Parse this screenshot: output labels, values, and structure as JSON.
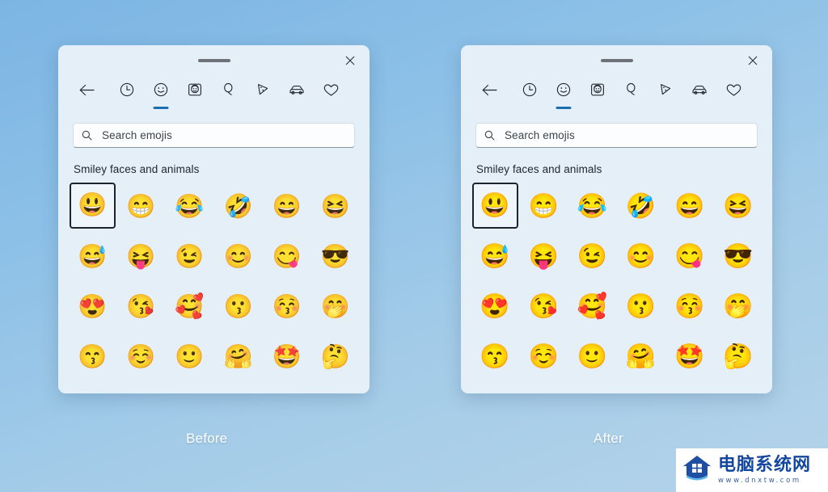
{
  "background": {
    "gradient_from": "#7cb5e3",
    "gradient_to": "#b4d3e9"
  },
  "panels": [
    {
      "id": "before",
      "caption": "Before",
      "titlebar": {
        "drag_handle_name": "drag-handle",
        "close_label": "×"
      },
      "tabs": [
        {
          "name": "back",
          "icon": "arrow-left-icon",
          "active": false
        },
        {
          "name": "recent",
          "icon": "clock-icon",
          "active": false
        },
        {
          "name": "emoji",
          "icon": "smiley-icon",
          "active": true
        },
        {
          "name": "gif",
          "icon": "person-icon",
          "active": false
        },
        {
          "name": "kaomoji",
          "icon": "balloon-icon",
          "active": false
        },
        {
          "name": "food",
          "icon": "pizza-icon",
          "active": false
        },
        {
          "name": "travel",
          "icon": "car-icon",
          "active": false
        },
        {
          "name": "symbols",
          "icon": "heart-icon",
          "active": false
        }
      ],
      "search": {
        "placeholder": "Search emojis",
        "value": "",
        "icon": "search-icon"
      },
      "section_title": "Smiley faces and animals",
      "grid": {
        "columns": 6,
        "selected_index": 0,
        "emojis": [
          {
            "glyph": "😃",
            "name": "grinning-face-with-big-eyes"
          },
          {
            "glyph": "😁",
            "name": "beaming-face-with-smiling-eyes"
          },
          {
            "glyph": "😂",
            "name": "face-with-tears-of-joy"
          },
          {
            "glyph": "🤣",
            "name": "rolling-on-the-floor-laughing"
          },
          {
            "glyph": "😄",
            "name": "grinning-face-with-smiling-eyes"
          },
          {
            "glyph": "😆",
            "name": "grinning-squinting-face"
          },
          {
            "glyph": "😅",
            "name": "grinning-face-with-sweat"
          },
          {
            "glyph": "😝",
            "name": "squinting-face-with-tongue"
          },
          {
            "glyph": "😉",
            "name": "winking-face"
          },
          {
            "glyph": "😊",
            "name": "smiling-face-with-smiling-eyes"
          },
          {
            "glyph": "😋",
            "name": "face-savoring-food"
          },
          {
            "glyph": "😎",
            "name": "smiling-face-with-sunglasses"
          },
          {
            "glyph": "😍",
            "name": "smiling-face-with-heart-eyes"
          },
          {
            "glyph": "😘",
            "name": "face-blowing-a-kiss"
          },
          {
            "glyph": "🥰",
            "name": "smiling-face-with-hearts"
          },
          {
            "glyph": "😗",
            "name": "kissing-face"
          },
          {
            "glyph": "😚",
            "name": "kissing-face-with-closed-eyes"
          },
          {
            "glyph": "🤭",
            "name": "face-with-hand-over-mouth"
          },
          {
            "glyph": "😙",
            "name": "kissing-face-with-smiling-eyes"
          },
          {
            "glyph": "☺️",
            "name": "smiling-face"
          },
          {
            "glyph": "🙂",
            "name": "slightly-smiling-face"
          },
          {
            "glyph": "🤗",
            "name": "hugging-face"
          },
          {
            "glyph": "🤩",
            "name": "star-struck"
          },
          {
            "glyph": "🤔",
            "name": "thinking-face"
          }
        ]
      }
    },
    {
      "id": "after",
      "caption": "After",
      "titlebar": {
        "drag_handle_name": "drag-handle",
        "close_label": "×"
      },
      "tabs": [
        {
          "name": "back",
          "icon": "arrow-left-icon",
          "active": false
        },
        {
          "name": "recent",
          "icon": "clock-icon",
          "active": false
        },
        {
          "name": "emoji",
          "icon": "smiley-icon",
          "active": true
        },
        {
          "name": "gif",
          "icon": "person-icon",
          "active": false
        },
        {
          "name": "kaomoji",
          "icon": "balloon-icon",
          "active": false
        },
        {
          "name": "food",
          "icon": "pizza-icon",
          "active": false
        },
        {
          "name": "travel",
          "icon": "car-icon",
          "active": false
        },
        {
          "name": "symbols",
          "icon": "heart-icon",
          "active": false
        }
      ],
      "search": {
        "placeholder": "Search emojis",
        "value": "",
        "icon": "search-icon"
      },
      "section_title": "Smiley faces and animals",
      "grid": {
        "columns": 6,
        "selected_index": 0,
        "emojis": [
          {
            "glyph": "😃",
            "name": "grinning-face-with-big-eyes"
          },
          {
            "glyph": "😁",
            "name": "beaming-face-with-smiling-eyes"
          },
          {
            "glyph": "😂",
            "name": "face-with-tears-of-joy"
          },
          {
            "glyph": "🤣",
            "name": "rolling-on-the-floor-laughing"
          },
          {
            "glyph": "😄",
            "name": "grinning-face-with-smiling-eyes"
          },
          {
            "glyph": "😆",
            "name": "grinning-squinting-face"
          },
          {
            "glyph": "😅",
            "name": "grinning-face-with-sweat"
          },
          {
            "glyph": "😝",
            "name": "squinting-face-with-tongue"
          },
          {
            "glyph": "😉",
            "name": "winking-face"
          },
          {
            "glyph": "😊",
            "name": "smiling-face-with-smiling-eyes"
          },
          {
            "glyph": "😋",
            "name": "face-savoring-food"
          },
          {
            "glyph": "😎",
            "name": "smiling-face-with-sunglasses"
          },
          {
            "glyph": "😍",
            "name": "smiling-face-with-heart-eyes"
          },
          {
            "glyph": "😘",
            "name": "face-blowing-a-kiss"
          },
          {
            "glyph": "🥰",
            "name": "smiling-face-with-hearts"
          },
          {
            "glyph": "😗",
            "name": "kissing-face"
          },
          {
            "glyph": "😚",
            "name": "kissing-face-with-closed-eyes"
          },
          {
            "glyph": "🤭",
            "name": "face-with-hand-over-mouth"
          },
          {
            "glyph": "😙",
            "name": "kissing-face-with-smiling-eyes"
          },
          {
            "glyph": "☺️",
            "name": "smiling-face"
          },
          {
            "glyph": "🙂",
            "name": "slightly-smiling-face"
          },
          {
            "glyph": "🤗",
            "name": "hugging-face"
          },
          {
            "glyph": "🤩",
            "name": "star-struck"
          },
          {
            "glyph": "🤔",
            "name": "thinking-face"
          }
        ]
      }
    }
  ],
  "watermark": {
    "site_name": "电脑系统网",
    "url": "www.dnxtw.com",
    "icon": "house-icon",
    "color": "#14489e"
  },
  "theme": {
    "panel_bg": "#e4eff8",
    "accent": "#1b6fb0",
    "text": "#1e242b"
  }
}
